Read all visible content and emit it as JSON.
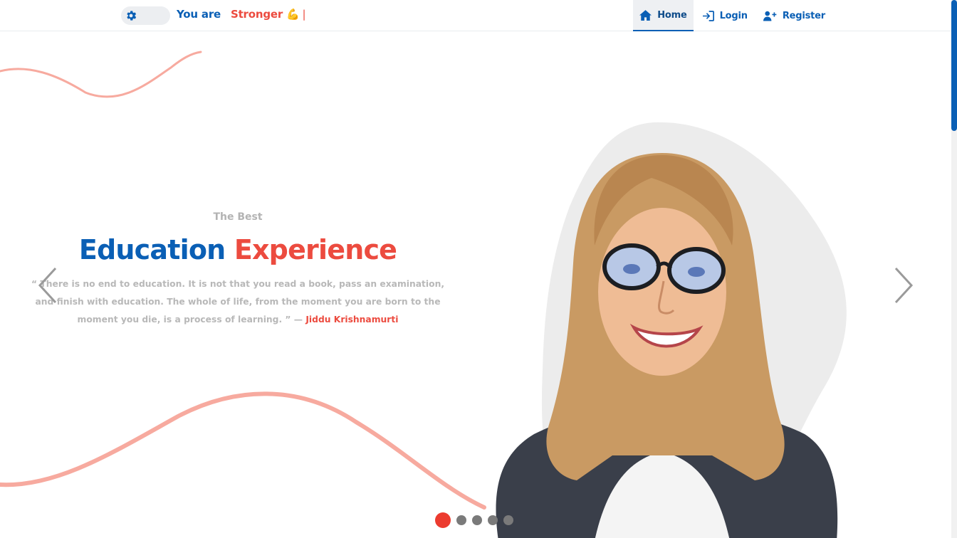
{
  "navbar": {
    "brand": {
      "static_text": "You are",
      "typed_text": "Stronger 💪",
      "cursor": "|"
    },
    "theme_toggle": {
      "icon": "gear-icon"
    },
    "menu": [
      {
        "label": "Home",
        "icon": "home-icon",
        "active": true
      },
      {
        "label": "Login",
        "icon": "login-icon",
        "active": false
      },
      {
        "label": "Register",
        "icon": "user-plus-icon",
        "active": false
      }
    ]
  },
  "hero": {
    "eyebrow": "The Best",
    "headline_part1": "Education",
    "headline_part2": "Experience",
    "quote": "“ There is no end to education. It is not that you read a book, pass an examination, and finish with education. The whole of life, from the moment you are born to the moment you die, is a process of learning. ” —",
    "quote_author": "Jiddu Krishnamurti",
    "carousel": {
      "slide_count": 5,
      "active_index": 0
    }
  },
  "colors": {
    "primary_blue": "#0a5fb5",
    "accent_red": "#ec4b3f",
    "wave_salmon": "#f7aa9f",
    "muted_text": "#b8b8b8"
  }
}
